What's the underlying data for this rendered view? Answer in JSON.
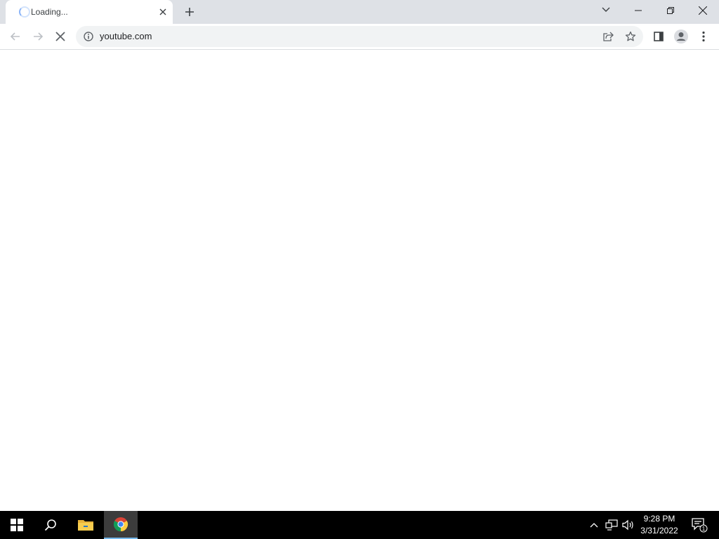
{
  "browser": {
    "tab": {
      "title": "Loading...",
      "favicon": "loading-spinner-icon",
      "close_icon": "close-icon"
    },
    "new_tab_icon": "plus-icon",
    "tab_search_icon": "chevron-down-icon",
    "window_controls": {
      "minimize_icon": "minimize-icon",
      "restore_icon": "restore-icon",
      "close_icon": "close-icon"
    },
    "toolbar": {
      "back_icon": "back-arrow-icon",
      "forward_icon": "forward-arrow-icon",
      "stop_icon": "stop-icon",
      "url": "youtube.com",
      "site_info_icon": "info-icon",
      "share_icon": "share-icon",
      "bookmark_icon": "star-icon",
      "side_panel_icon": "side-panel-icon",
      "profile_icon": "profile-icon",
      "menu_icon": "kebab-menu-icon"
    }
  },
  "taskbar": {
    "start_icon": "windows-start-icon",
    "search_icon": "search-icon",
    "apps": [
      {
        "name": "File Explorer",
        "icon": "folder-icon"
      },
      {
        "name": "Google Chrome",
        "icon": "chrome-icon",
        "active": true
      }
    ],
    "tray": {
      "clock_time": "9:28 PM",
      "clock_date": "3/31/2022",
      "notifications_count": "1"
    }
  },
  "colors": {
    "tabstrip_bg": "#dee1e6",
    "omnibox_bg": "#f1f3f4",
    "taskbar_bg": "#000000",
    "active_app_accent": "#76b9ed"
  }
}
